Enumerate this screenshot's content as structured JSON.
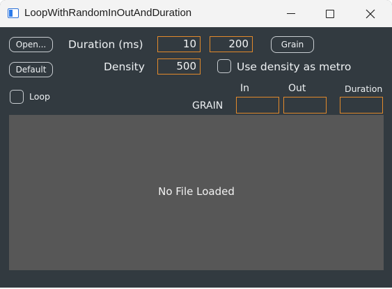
{
  "window": {
    "title": "LoopWithRandomInOutAndDuration"
  },
  "buttons": {
    "open": "Open...",
    "default": "Default",
    "grain": "Grain"
  },
  "duration": {
    "label": "Duration (ms)",
    "min": "10",
    "max": "200"
  },
  "density": {
    "label": "Density",
    "value": "500",
    "metro_checkbox_label": "Use density as metro",
    "metro_checked": false
  },
  "loop": {
    "label": "Loop",
    "checked": false
  },
  "grain_display": {
    "label": "GRAIN",
    "in_header": "In",
    "out_header": "Out",
    "duration_header": "Duration",
    "in_value": "",
    "out_value": "",
    "duration_value": ""
  },
  "waveform": {
    "status": "No File Loaded"
  },
  "colors": {
    "background": "#323a40",
    "accent_border": "#e38a2b",
    "waveform_bg": "#575757",
    "titlebar": "#f3f3f3"
  }
}
